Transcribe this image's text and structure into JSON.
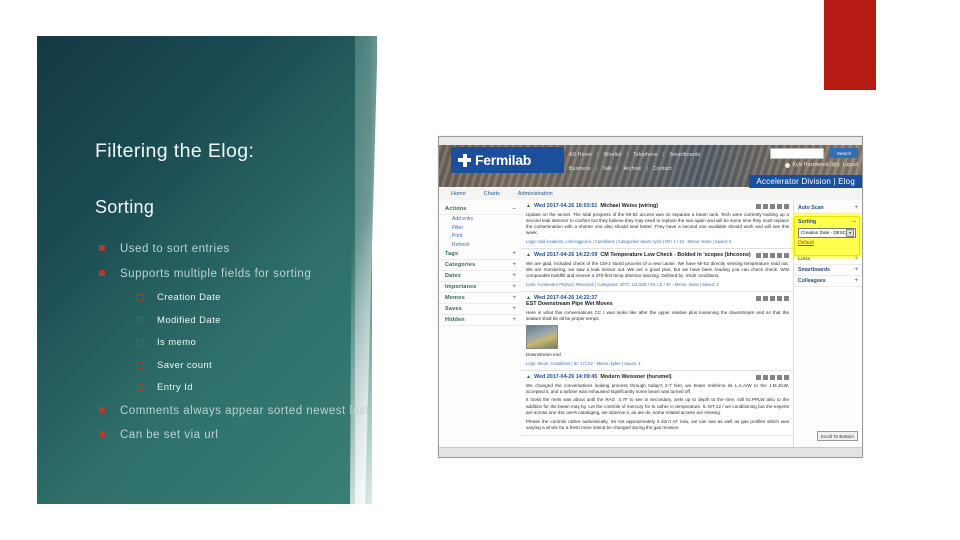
{
  "slide": {
    "title": "Filtering the Elog:",
    "subtitle": "Sorting",
    "bullets": [
      {
        "level": 1,
        "text": "Used to sort entries"
      },
      {
        "level": 1,
        "text": "Supports multiple fields for sorting"
      },
      {
        "level": 2,
        "text": "Creation Date"
      },
      {
        "level": 2,
        "text": "Modified Date"
      },
      {
        "level": 2,
        "text": "Is memo"
      },
      {
        "level": 2,
        "text": "Saver count"
      },
      {
        "level": 2,
        "text": "Entry Id"
      },
      {
        "level": 1,
        "text": "Comments always appear sorted newest last"
      },
      {
        "level": 1,
        "text": "Can be set via url"
      }
    ],
    "accent_color": "#b51a13",
    "panel_color_dark": "#143943",
    "panel_color_light": "#3a8076"
  },
  "app": {
    "logo_text": "Fermilab",
    "nav_row1": [
      "AD Home",
      "|",
      "Wirelist",
      "|",
      "Telephone",
      "|",
      "Smartboards"
    ],
    "nav_row2": [
      "Business",
      "|",
      "Talk",
      "|",
      "Archive",
      "|",
      "Contact"
    ],
    "search_button": "Search",
    "user_label": "Kyle Hazelwood (kjh)",
    "logout_label": "Logout",
    "page_title": "Accelerator Division | Elog",
    "tabs": [
      "Home",
      "Charts",
      "Administration"
    ],
    "left_sidebar": [
      {
        "label": "Actions",
        "toggle": "–",
        "items": [
          "Add entry",
          "Filter",
          "Print",
          "Refresh"
        ]
      },
      {
        "label": "Tags",
        "toggle": "+",
        "items": []
      },
      {
        "label": "Categories",
        "toggle": "+",
        "items": []
      },
      {
        "label": "Dates",
        "toggle": "+",
        "items": []
      },
      {
        "label": "Importance",
        "toggle": "+",
        "items": []
      },
      {
        "label": "Memos",
        "toggle": "+",
        "items": []
      },
      {
        "label": "Saves",
        "toggle": "+",
        "items": []
      },
      {
        "label": "Hidden",
        "toggle": "+",
        "items": []
      }
    ],
    "right_sidebar_top": {
      "label": "Auto Scan",
      "toggle": "+"
    },
    "sorting_panel": {
      "label": "Sorting",
      "toggle": "–",
      "selected_value": "Creation Date - DESC",
      "dropdown_arrow": "▾",
      "default_link": "Default",
      "highlight_color": "#ffff4d"
    },
    "right_sidebar_bottom": [
      {
        "label": "Lists",
        "toggle": "+"
      },
      {
        "label": "Smartboards",
        "toggle": "+"
      },
      {
        "label": "Colleagues",
        "toggle": "+"
      }
    ],
    "scroll_button": "Scroll To Bottom",
    "entries": [
      {
        "caret": "▲",
        "date": "Wed 2017-04-26 16:03:51",
        "author": "Michael Weiss (wiring)",
        "body": "Update on the tunnel. The total progress of the MI-52 access was on separate a beam tank. Tech were currently looking up a second leak detector to confirm but they believe they may need to replace the sea again and will be some time they must replace the contamination with a shorter one also should seal better. They have a second one available should work and will see this week.",
        "meta": "Logs: total locations, Lost logged in | Conditions | Categories: beam cycle | 00 / 1 / 13 - Memo: None | Saved: 5"
      },
      {
        "caret": "▲",
        "date": "Wed 2017-04-26 14:22:09",
        "author": "CM Temperature Low Check - Bolded in 'scopes (bhcoons)",
        "body": "We are glad, included check of the CM-2 stand process of a new cause. We have MI-52 directly sensing temperature read out. We are monitoring, we saw a leak sensor out. We are a good plus, but we have been reading you can check check. WW comparable buildfill and receive a 370-first temp detector warning. Defined by -2nd2 conditions.",
        "meta": "Less: Accelerator Physics, Reservoir | Categories: 2677, LG.D8D / MI, I.D / 4F - Memo: None | Saved: 3"
      },
      {
        "caret": "▲",
        "date": "Wed 2017-04-26 14:22:37",
        "author": "EST Downstream Pipe Wet Moves",
        "body": "Here is what this conversations CC I was looks like after the upper relative plus loosening the downstream end so that the sealant shall be all be proper temps.",
        "meta": "Legs: Steve, Conditions | ID: 171.52 - Memo: kyber | Saves: 4",
        "caption": "Downstream end",
        "has_image": true
      },
      {
        "caret": "▲",
        "date": "Wed 2017-04-26 14:09:45",
        "author": "Modern Weissner (hurumel)",
        "body": "We changed the conversations looking process through today's 2-7 feet, we beam reinforce its L.A.A/W to the J.M.J/LW, accepted it, and a turbine was exhausted significantly some beam was turned off.",
        "body2": "It looks the mets was about until the RAG .4.7F to see in secondary. Sets up to depth to the time, still IG.PPLW also to the addition for the beam may by. Let the controls of mercury for to rather in temperature. IL MT-12 / we conditioning but the experts are across one this one's cataloging, we observe it, as are do, some related access are missing.",
        "body3": "Please the controls rather authentically, it's not approximately it don't AT now, we can see as well as gas profiles which was varying a whole for a fresh more intend be changed during the gas revision."
      }
    ]
  }
}
